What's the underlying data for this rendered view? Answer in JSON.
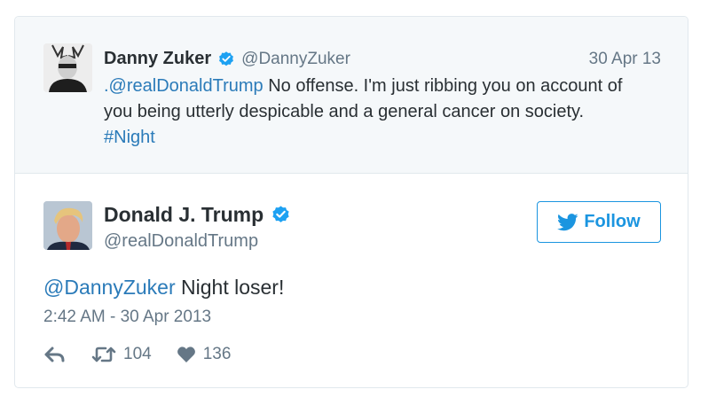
{
  "quoted": {
    "name": "Danny Zuker",
    "handle": "@DannyZuker",
    "date": "30 Apr 13",
    "mention": ".@realDonaldTrump",
    "text_line1": " No offense. I'm just ribbing you on account of",
    "text_line2": "you being utterly despicable and a general cancer on society.",
    "hashtag": "#Night"
  },
  "tweet": {
    "name": "Donald J. Trump",
    "handle": "@realDonaldTrump",
    "follow_label": "Follow",
    "mention": "@DannyZuker",
    "text": " Night loser!",
    "timestamp": "2:42 AM - 30 Apr 2013",
    "retweets": "104",
    "likes": "136"
  },
  "icons": {
    "verified": "verified-badge-icon",
    "follow": "twitter-bird-icon",
    "reply": "reply-icon",
    "retweet": "retweet-icon",
    "like": "heart-icon"
  },
  "colors": {
    "link": "#2b7bb9",
    "verified": "#1da1f2",
    "muted": "#657786",
    "quote_bg": "#f5f8fa"
  }
}
